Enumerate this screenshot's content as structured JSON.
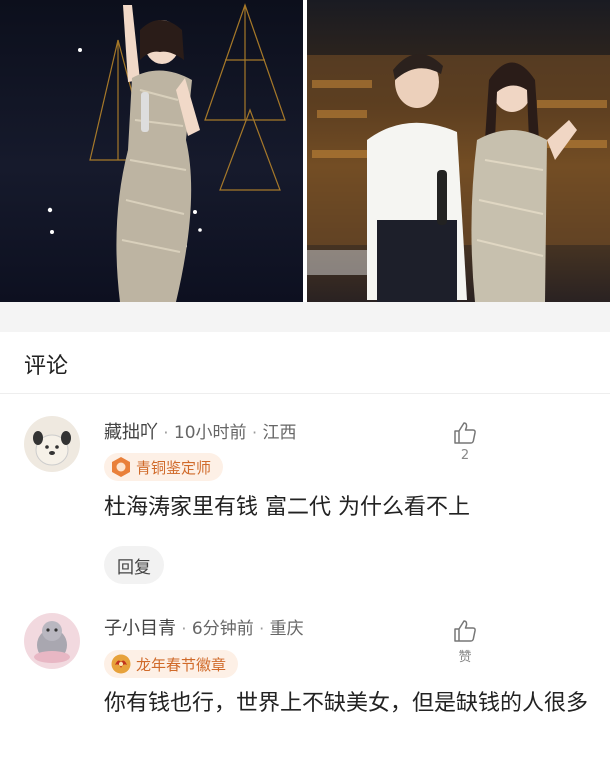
{
  "photos": [
    {
      "label": "photo-left"
    },
    {
      "label": "photo-right"
    }
  ],
  "comments_section": {
    "title": "评论"
  },
  "comments": [
    {
      "name": "藏拙吖",
      "time": "10小时前",
      "location": "江西",
      "badge": "青铜鉴定师",
      "badge_icon": "bronze-appraiser-icon",
      "text": "杜海涛家里有钱 富二代 为什么看不上",
      "reply_label": "回复",
      "likes": "2"
    },
    {
      "name": "子小目青",
      "time": "6分钟前",
      "location": "重庆",
      "badge": "龙年春节徽章",
      "badge_icon": "dragon-new-year-icon",
      "text": "你有钱也行，世界上不缺美女，但是缺钱的人很多",
      "likes": "赞"
    }
  ],
  "separator": "·",
  "colors": {
    "badge_bg": "#fdf0e6",
    "badge_text": "#d06a2a",
    "meta_gray": "#666666"
  }
}
